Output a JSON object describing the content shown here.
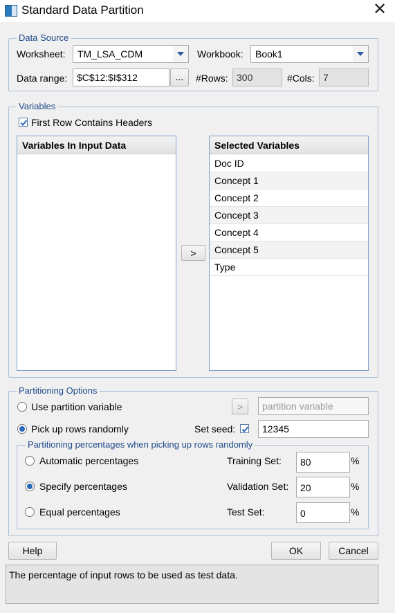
{
  "window": {
    "title": "Standard Data Partition",
    "close_glyph": "✕"
  },
  "data_source": {
    "legend": "Data Source",
    "worksheet_label": "Worksheet:",
    "worksheet_value": "TM_LSA_CDM",
    "workbook_label": "Workbook:",
    "workbook_value": "Book1",
    "range_label": "Data range:",
    "range_value": "$C$12:$I$312",
    "range_button": "...",
    "rows_label": "#Rows:",
    "rows_value": "300",
    "cols_label": "#Cols:",
    "cols_value": "7"
  },
  "variables": {
    "legend": "Variables",
    "first_row_headers_label": "First Row Contains Headers",
    "first_row_headers_checked": true,
    "input_header": "Variables In Input Data",
    "input_items": [],
    "move_button": ">",
    "selected_header": "Selected Variables",
    "selected_items": [
      "Doc ID",
      "Concept 1",
      "Concept 2",
      "Concept 3",
      "Concept 4",
      "Concept 5",
      "Type"
    ]
  },
  "partitioning": {
    "legend": "Partitioning Options",
    "use_variable_label": "Use partition variable",
    "use_variable_selected": false,
    "variable_move_button": ">",
    "variable_placeholder": "partition variable",
    "pick_random_label": "Pick up rows randomly",
    "pick_random_selected": true,
    "set_seed_label": "Set seed:",
    "set_seed_checked": true,
    "seed_value": "12345",
    "percentages": {
      "legend": "Partitioning percentages when picking up rows randomly",
      "automatic_label": "Automatic percentages",
      "specify_label": "Specify percentages",
      "equal_label": "Equal percentages",
      "selected": "specify",
      "training_label": "Training Set:",
      "training_value": "80",
      "validation_label": "Validation Set:",
      "validation_value": "20",
      "test_label": "Test Set:",
      "test_value": "0",
      "percent_sign": "%"
    }
  },
  "buttons": {
    "help": "Help",
    "ok": "OK",
    "cancel": "Cancel"
  },
  "status_text": "The percentage of input rows to be used as test data.",
  "colors": {
    "accent": "#2a68b8",
    "legend_text": "#1f4a8a",
    "group_border": "#a9bed4"
  },
  "icons": {
    "app": "app-window-icon",
    "close": "close-icon",
    "dropdown": "chevron-down-icon",
    "check": "checkmark-icon"
  }
}
